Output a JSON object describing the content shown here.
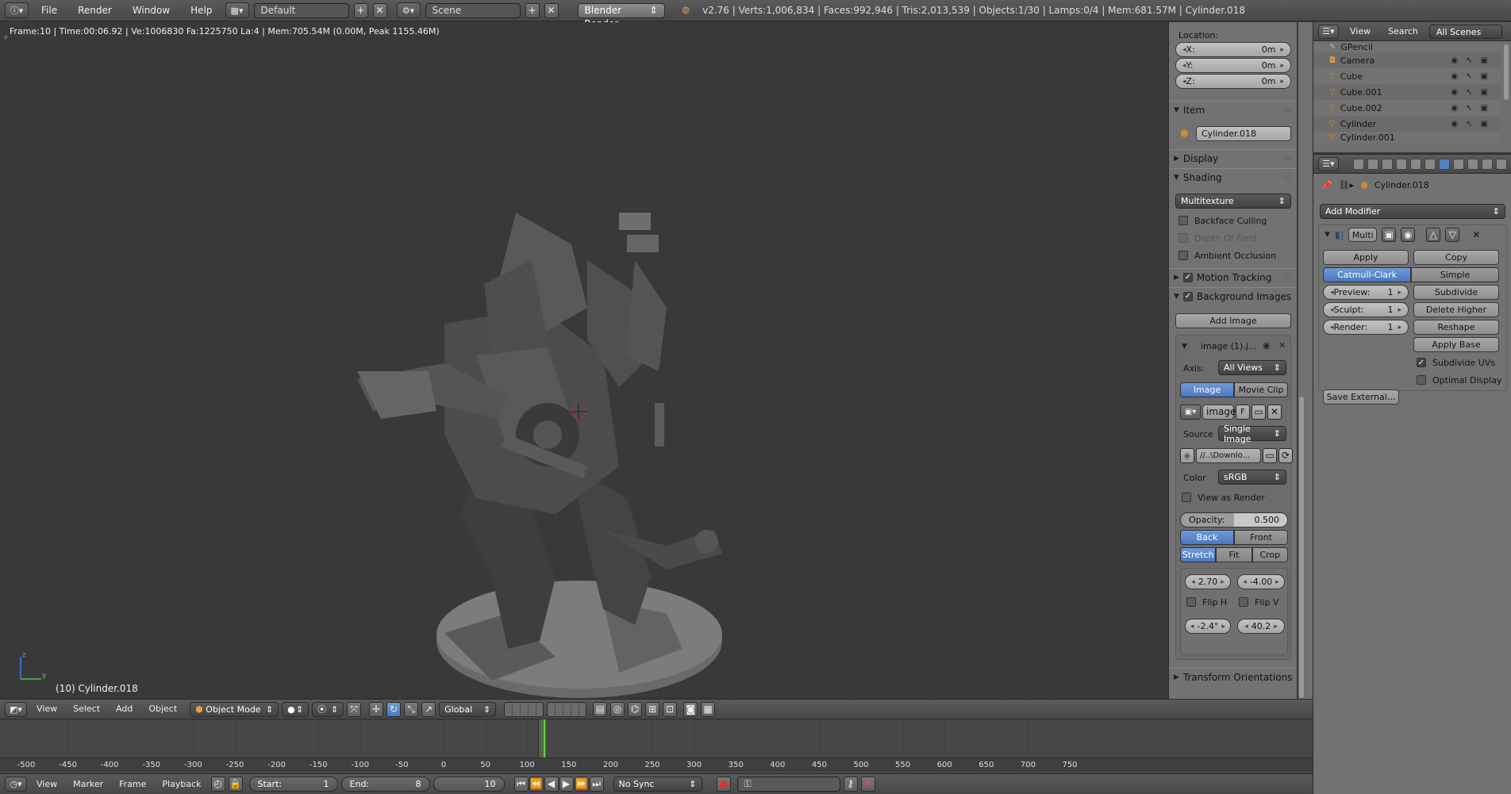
{
  "topbar": {
    "menus": [
      "File",
      "Render",
      "Window",
      "Help"
    ],
    "layout": "Default",
    "scene": "Scene",
    "engine": "Blender Render",
    "stats": "v2.76 | Verts:1,006,834 | Faces:992,946 | Tris:2,013,539 | Objects:1/30 | Lamps:0/4 | Mem:681.57M | Cylinder.018"
  },
  "viewport": {
    "info": "Frame:10 | Time:00:06.92 | Ve:1006830 Fa:1225750 La:4 | Mem:705.54M (0.00M, Peak 1155.46M)",
    "object_label": "(10) Cylinder.018"
  },
  "npanel": {
    "location_label": "Location:",
    "x": {
      "label": "X:",
      "value": "0m"
    },
    "y": {
      "label": "Y:",
      "value": "0m"
    },
    "z": {
      "label": "Z:",
      "value": "0m"
    },
    "item_header": "Item",
    "object_name": "Cylinder.018",
    "display_header": "Display",
    "shading_header": "Shading",
    "shading_mode": "Multitexture",
    "backface": "Backface Culling",
    "dof": "Depth Of Field",
    "ao": "Ambient Occlusion",
    "motion_tracking": "Motion Tracking",
    "bg_images": "Background Images",
    "add_image": "Add Image",
    "image_name": "image (1).j...",
    "axis_label": "Axis:",
    "axis_value": "All Views",
    "tab_image": "Image",
    "tab_movie": "Movie Clip",
    "img_field": "image",
    "img_f": "F",
    "source_label": "Source",
    "source_value": "Single Image",
    "path_value": "//..\\Downlo...",
    "color_label": "Color",
    "color_value": "sRGB",
    "view_as_render": "View as Render",
    "opacity_label": "Opacity:",
    "opacity_value": "0.500",
    "back": "Back",
    "front": "Front",
    "stretch": "Stretch",
    "fit": "Fit",
    "crop": "Crop",
    "offset_x": "2.70",
    "offset_y": "-4.00",
    "flip_h": "Flip H",
    "flip_v": "Flip V",
    "rotation": "-2.4°",
    "size": "40.2",
    "transform_orient": "Transform Orientations"
  },
  "outliner": {
    "menu_view": "View",
    "menu_search": "Search",
    "scenes_select": "All Scenes",
    "items": [
      "GPencil",
      "Camera",
      "Cube",
      "Cube.001",
      "Cube.002",
      "Cylinder",
      "Cylinder.001"
    ]
  },
  "props": {
    "object_name": "Cylinder.018",
    "add_modifier": "Add Modifier",
    "mod_name": "Multi",
    "apply": "Apply",
    "copy": "Copy",
    "catmull": "Catmull-Clark",
    "simple": "Simple",
    "preview_label": "Preview:",
    "preview_value": "1",
    "sculpt_label": "Sculpt:",
    "sculpt_value": "1",
    "render_label": "Render:",
    "render_value": "1",
    "subdivide": "Subdivide",
    "delete_higher": "Delete Higher",
    "reshape": "Reshape",
    "apply_base": "Apply Base",
    "subdivide_uvs": "Subdivide UVs",
    "optimal_display": "Optimal Display",
    "save_external": "Save External..."
  },
  "vp_header": {
    "menus": [
      "View",
      "Select",
      "Add",
      "Object"
    ],
    "mode": "Object Mode",
    "orientation": "Global"
  },
  "timeline": {
    "ticks": [
      -500,
      -450,
      -400,
      -350,
      -300,
      -250,
      -200,
      -150,
      -100,
      -50,
      0,
      50,
      100,
      150,
      200,
      250,
      300,
      350,
      400,
      450,
      500,
      550,
      600,
      650,
      700,
      750
    ],
    "current_frame": 10
  },
  "tl_header": {
    "menus": [
      "View",
      "Marker",
      "Frame",
      "Playback"
    ],
    "start_label": "Start:",
    "start_value": "1",
    "end_label": "End:",
    "end_value": "8",
    "frame_value": "10",
    "sync": "No Sync"
  },
  "colors": {
    "accent_blue": "#5680c2",
    "viewport_bg": "#393939",
    "panel_bg": "#727272",
    "playhead": "#60d040"
  }
}
